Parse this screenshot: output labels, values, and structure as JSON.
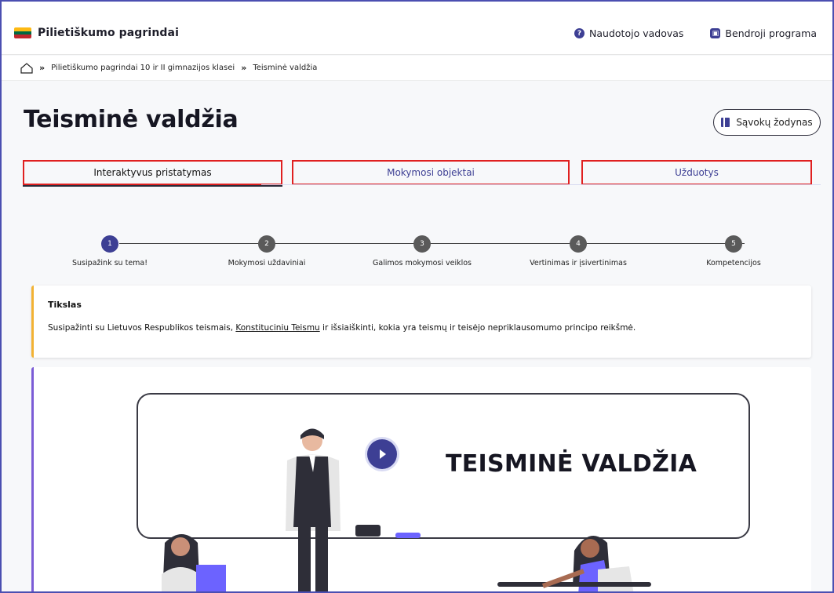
{
  "header": {
    "app_title": "Pilietiškumo pagrindai",
    "flag_colors": [
      "#fdb913",
      "#006a44",
      "#c1272d"
    ],
    "nav": [
      {
        "label": "Naudotojo vadovas",
        "icon": "question-circle-icon"
      },
      {
        "label": "Bendroji programa",
        "icon": "book-icon"
      }
    ]
  },
  "breadcrumb": {
    "home_icon": "home-icon",
    "items": [
      "Pilietiškumo pagrindai 10 ir II gimnazijos klasei",
      "Teisminė valdžia"
    ]
  },
  "page": {
    "title": "Teisminė valdžia",
    "glossary_button": "Sąvokų žodynas"
  },
  "tabs": [
    {
      "label": "Interaktyvus pristatymas",
      "active": true
    },
    {
      "label": "Mokymosi objektai",
      "active": false
    },
    {
      "label": "Užduotys",
      "active": false
    }
  ],
  "stepper": {
    "active_step": 1,
    "steps": [
      {
        "number": "1",
        "label": "Susipažink su tema!"
      },
      {
        "number": "2",
        "label": "Mokymosi uždaviniai"
      },
      {
        "number": "3",
        "label": "Galimos mokymosi veiklos"
      },
      {
        "number": "4",
        "label": "Vertinimas ir įsivertinimas"
      },
      {
        "number": "5",
        "label": "Kompetencijos"
      }
    ]
  },
  "goal": {
    "title": "Tikslas",
    "text_before": "Susipažinti su Lietuvos Respublikos teismais, ",
    "link_text": "Konstituciniu Teismu",
    "text_after": " ir išsiaiškinti, kokia yra teismų ir teisėjo nepriklausomumo principo reikšmė."
  },
  "video": {
    "title": "TEISMINĖ VALDŽIA",
    "play_icon": "play-icon"
  },
  "colors": {
    "accent": "#3d3f94",
    "highlight_border": "#e02020",
    "goal_accent": "#f2b233",
    "media_accent": "#7b5cd6"
  }
}
